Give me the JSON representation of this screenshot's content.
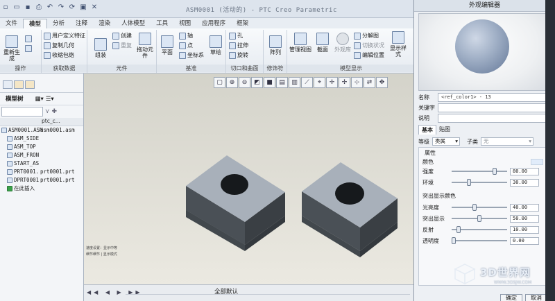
{
  "window": {
    "title": "ASM0001 (活动的) - PTC Creo Parametric"
  },
  "tabs": [
    "文件",
    "模型",
    "分析",
    "注释",
    "渲染",
    "人体模型",
    "工具",
    "视图",
    "应用程序",
    "框架"
  ],
  "active_tab_index": 1,
  "ribbon": {
    "operations": {
      "label": "操作",
      "regenerate": "重新生成"
    },
    "get_data": {
      "label": "获取数据",
      "items": [
        "用户定义特征",
        "复制几何",
        "收缩包络"
      ]
    },
    "component": {
      "label": "元件",
      "assemble": "组装",
      "create": "创建",
      "repeat": "重复",
      "drag": "拖动元件"
    },
    "datum": {
      "label": "基准",
      "plane": "平面",
      "axis": "轴",
      "point": "点",
      "csys": "坐标系",
      "sketch": "草绘"
    },
    "cut_surface": {
      "label": "切口和曲面",
      "hole": "孔",
      "extrude": "拉伸",
      "revolve": "旋转"
    },
    "modifiers": {
      "label": "修饰符",
      "pattern": "阵列"
    },
    "model_display": {
      "label": "模型显示",
      "manage_views": "管理视图",
      "section": "截面",
      "appearance": "外观库",
      "explode": "分解图",
      "toggle_state": "切换状况",
      "edit_position": "编辑位置",
      "display_style": "显示样式"
    }
  },
  "model_tree": {
    "header": "模型树",
    "column": "ptc_c...",
    "rows": [
      {
        "name": "ASM0001.ASM",
        "col": "asm0001.asm"
      },
      {
        "name": "ASM_SIDE",
        "col": ""
      },
      {
        "name": "ASM_TOP",
        "col": ""
      },
      {
        "name": "ASM_FRON",
        "col": ""
      },
      {
        "name": "START_AS",
        "col": ""
      },
      {
        "name": "PRT0001.",
        "col": "prt0001.prt"
      },
      {
        "name": "DPRT0001",
        "col": "prt0001.prt"
      },
      {
        "name": "在此插入",
        "col": ""
      }
    ]
  },
  "viewport": {
    "note_line1": "速度设置：显示中等",
    "note_line2": "细节细节 | 显示模式"
  },
  "bottom": {
    "filter": "全部默认"
  },
  "appearance_editor": {
    "title": "外观编辑器",
    "name_label": "名称",
    "name_value": "<ref_color1> - 13",
    "keyword_label": "关键字",
    "description_label": "说明",
    "tab_basic": "基本",
    "tab_map": "贴图",
    "class_label": "等级",
    "class_value": "类属",
    "subclass_label": "子类",
    "subclass_value": "无",
    "props_title": "属性",
    "color_label": "颜色",
    "highlight_title": "突出显示颜色",
    "color_hex": "#e1ecfa",
    "rows": [
      {
        "label": "强度",
        "value": "80.00",
        "fraction": 0.8
      },
      {
        "label": "环境",
        "value": "30.00",
        "fraction": 0.3
      },
      {
        "label": "光亮度",
        "value": "40.00",
        "fraction": 0.4
      },
      {
        "label": "突出显示",
        "value": "50.00",
        "fraction": 0.5
      },
      {
        "label": "反射",
        "value": "10.00",
        "fraction": 0.1
      },
      {
        "label": "透明度",
        "value": "0.00",
        "fraction": 0.0
      }
    ],
    "ok": "确定",
    "cancel": "取消"
  },
  "watermark": {
    "brand": "3D世界网",
    "url": "WWW.3DSJW.COM"
  }
}
